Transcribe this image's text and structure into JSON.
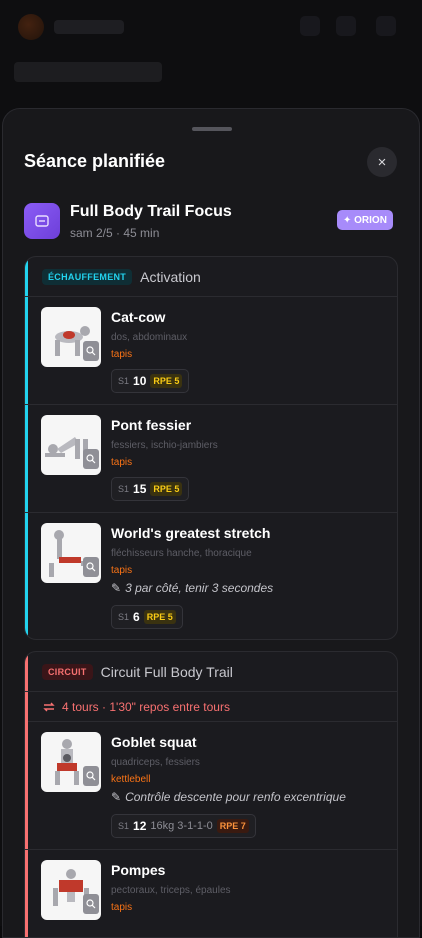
{
  "sheet": {
    "title": "Séance planifiée",
    "close_icon": "×"
  },
  "workout": {
    "name": "Full Body Trail Focus",
    "meta": "sam 2/5 · 45 min",
    "badge": "✦ ORION"
  },
  "blocks": [
    {
      "tag": "ÉCHAUFFEMENT",
      "name": "Activation",
      "accent": "#22d3ee",
      "exercises": [
        {
          "name": "Cat-cow",
          "muscles": "dos, abdominaux",
          "equipment": "tapis",
          "set_label": "S1",
          "reps": "10",
          "rpe": "RPE 5"
        },
        {
          "name": "Pont fessier",
          "muscles": "fessiers, ischio-jambiers",
          "equipment": "tapis",
          "set_label": "S1",
          "reps": "15",
          "rpe": "RPE 5"
        },
        {
          "name": "World's greatest stretch",
          "muscles": "fléchisseurs hanche, thoracique",
          "equipment": "tapis",
          "note": "3 par côté, tenir 3 secondes",
          "set_label": "S1",
          "reps": "6",
          "rpe": "RPE 5"
        }
      ]
    },
    {
      "tag": "CIRCUIT",
      "name": "Circuit Full Body Trail",
      "accent": "#f87171",
      "rounds": "4 tours · 1'30\" repos entre tours",
      "exercises": [
        {
          "name": "Goblet squat",
          "muscles": "quadriceps, fessiers",
          "equipment": "kettlebell",
          "note": "Contrôle descente pour renfo excentrique",
          "set_label": "S1",
          "reps": "12",
          "extra": "16kg 3-1-1-0",
          "rpe": "RPE 7"
        },
        {
          "name": "Pompes",
          "muscles": "pectoraux, triceps, épaules",
          "equipment": "tapis"
        }
      ]
    }
  ]
}
